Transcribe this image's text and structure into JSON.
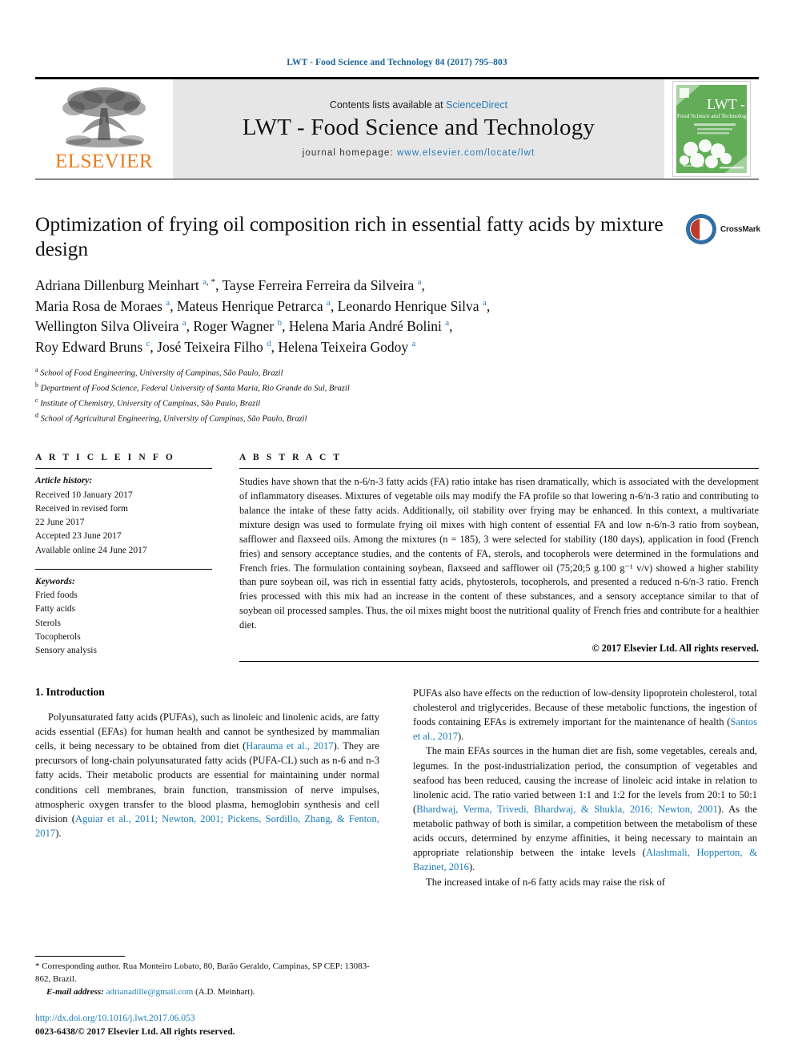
{
  "running_head": "LWT - Food Science and Technology 84 (2017) 795–803",
  "masthead": {
    "contents_prefix": "Contents lists available at ",
    "sciencedirect": "ScienceDirect",
    "journal_title": "LWT - Food Science and Technology",
    "homepage_label": "journal homepage: ",
    "homepage_url": "www.elsevier.com/locate/lwt",
    "publisher": "ELSEVIER",
    "cover_title_top": "LWT -",
    "cover_title_sub": "Food Science and Technology",
    "accent_blue": "#2b7bb9",
    "elsevier_orange": "#E87D1E",
    "cover_green": "#5aa84f"
  },
  "article": {
    "title": "Optimization of frying oil composition rich in essential fatty acids by mixture design",
    "crossmark_label": "CrossMark",
    "authors_html": "Adriana Dillenburg Meinhart <sup>a</sup><sup class=\"star\">, *</sup>, Tayse Ferreira Ferreira da Silveira <sup>a</sup>,<br>Maria Rosa de Moraes <sup>a</sup>, Mateus Henrique Petrarca <sup>a</sup>, Leonardo Henrique Silva <sup>a</sup>,<br>Wellington Silva Oliveira <sup>a</sup>, Roger Wagner <sup>b</sup>, Helena Maria André Bolini <sup>a</sup>,<br>Roy Edward Bruns <sup>c</sup>, José Teixeira Filho <sup>d</sup>, Helena Teixeira Godoy <sup>a</sup>",
    "affiliations": [
      {
        "mark": "a",
        "text": "School of Food Engineering, University of Campinas, São Paulo, Brazil"
      },
      {
        "mark": "b",
        "text": "Department of Food Science, Federal University of Santa Maria, Rio Grande do Sul, Brazil"
      },
      {
        "mark": "c",
        "text": "Institute of Chemistry, University of Campinas, São Paulo, Brazil"
      },
      {
        "mark": "d",
        "text": "School of Agricultural Engineering, University of Campinas, São Paulo, Brazil"
      }
    ]
  },
  "article_info": {
    "heading": "A R T I C L E   I N F O",
    "history_label": "Article history:",
    "history": [
      "Received 10 January 2017",
      "Received in revised form",
      "22 June 2017",
      "Accepted 23 June 2017",
      "Available online 24 June 2017"
    ],
    "keywords_label": "Keywords:",
    "keywords": [
      "Fried foods",
      "Fatty acids",
      "Sterols",
      "Tocopherols",
      "Sensory analysis"
    ]
  },
  "abstract": {
    "heading": "A B S T R A C T",
    "text": "Studies have shown that the n-6/n-3 fatty acids (FA) ratio intake has risen dramatically, which is associated with the development of inflammatory diseases. Mixtures of vegetable oils may modify the FA profile so that lowering n-6/n-3 ratio and contributing to balance the intake of these fatty acids. Additionally, oil stability over frying may be enhanced. In this context, a multivariate mixture design was used to formulate frying oil mixes with high content of essential FA and low n-6/n-3 ratio from soybean, safflower and flaxseed oils. Among the mixtures (n = 185), 3 were selected for stability (180 days), application in food (French fries) and sensory acceptance studies, and the contents of FA, sterols, and tocopherols were determined in the formulations and French fries. The formulation containing soybean, flaxseed and safflower oil (75;20;5 g.100 g⁻¹ v/v) showed a higher stability than pure soybean oil, was rich in essential fatty acids, phytosterols, tocopherols, and presented a reduced n-6/n-3 ratio. French fries processed with this mix had an increase in the content of these substances, and a sensory acceptance similar to that of soybean oil processed samples. Thus, the oil mixes might boost the nutritional quality of French fries and contribute for a healthier diet.",
    "copyright": "© 2017 Elsevier Ltd. All rights reserved."
  },
  "introduction": {
    "heading": "1. Introduction",
    "left_paragraph_1_html": "Polyunsaturated fatty acids (PUFAs), such as linoleic and linolenic acids, are fatty acids essential (EFAs) for human health and cannot be synthesized by mammalian cells, it being necessary to be obtained from diet (<span class=\"cite\">Harauma et al., 2017</span>). They are precursors of long-chain polyunsaturated fatty acids (PUFA-CL) such as n-6 and n-3 fatty acids. Their metabolic products are essential for maintaining under normal conditions cell membranes, brain function, transmission of nerve impulses, atmospheric oxygen transfer to the blood plasma, hemoglobin synthesis and cell division (<span class=\"cite\">Aguiar et al., 2011; Newton, 2001; Pickens, Sordillo, Zhang, &amp; Fenton, 2017</span>).",
    "right_paragraph_1_html": "PUFAs also have effects on the reduction of low-density lipoprotein cholesterol, total cholesterol and triglycerides. Because of these metabolic functions, the ingestion of foods containing EFAs is extremely important for the maintenance of health (<span class=\"cite\">Santos et al., 2017</span>).",
    "right_paragraph_2_html": "The main EFAs sources in the human diet are fish, some vegetables, cereals and, legumes. In the post-industrialization period, the consumption of vegetables and seafood has been reduced, causing the increase of linoleic acid intake in relation to linolenic acid. The ratio varied between 1:1 and 1:2 for the levels from 20:1 to 50:1 (<span class=\"cite\">Bhardwaj, Verma, Trivedi, Bhardwaj, &amp; Shukla, 2016; Newton, 2001</span>). As the metabolic pathway of both is similar, a competition between the metabolism of these acids occurs, determined by enzyme affinities, it being necessary to maintain an appropriate relationship between the intake levels (<span class=\"cite\">Alashmali, Hopperton, &amp; Bazinet, 2016</span>).",
    "right_paragraph_3_html": "The increased intake of n-6 fatty acids may raise the risk of"
  },
  "footnote": {
    "corresponding_html": "<span class=\"star\">*</span> Corresponding author. Rua Monteiro Lobato, 80, Barão Geraldo, Campinas, SP CEP: 13083-862, Brazil.",
    "email_label": "E-mail address: ",
    "email": "adrianadille@gmail.com",
    "email_suffix": " (A.D. Meinhart).",
    "doi": "http://dx.doi.org/10.1016/j.lwt.2017.06.053",
    "issn_line": "0023-6438/© 2017 Elsevier Ltd. All rights reserved."
  }
}
